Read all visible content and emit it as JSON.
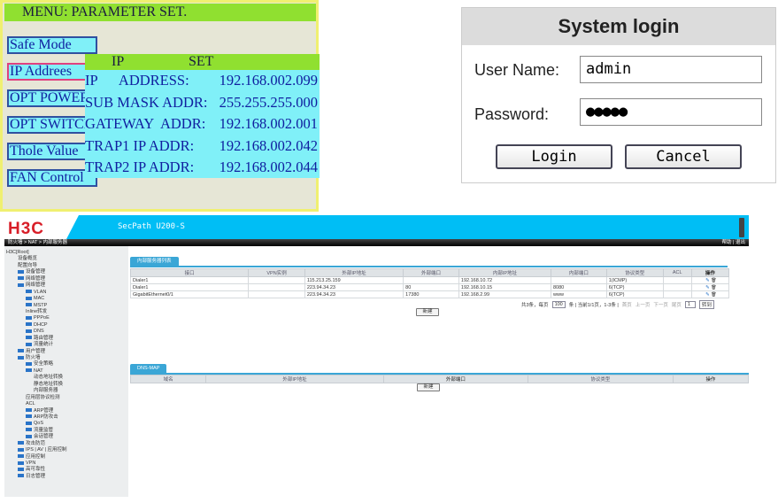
{
  "lcd": {
    "header": "MENU: PARAMETER SET.",
    "menu": [
      "Safe Mode",
      "IP Addrees",
      "OPT POWER",
      "OPT SWITCH",
      "Thole Value",
      "FAN Control"
    ],
    "popup": {
      "title_left": "IP",
      "title_right": "SET",
      "rows": [
        {
          "label": "IP      ADDRESS:",
          "value": "192.168.002.099"
        },
        {
          "label": "SUB MASK ADDR:",
          "value": "255.255.255.000"
        },
        {
          "label": "GATEWAY  ADDR:",
          "value": "192.168.002.001"
        },
        {
          "label": "TRAP1 IP ADDR:",
          "value": "192.168.002.042"
        },
        {
          "label": "TRAP2 IP ADDR:",
          "value": "192.168.002.044"
        }
      ]
    }
  },
  "login": {
    "title": "System login",
    "user_label": "User Name:",
    "user_value": "admin",
    "pass_label": "Password:",
    "pass_value": "●●●●●",
    "login_btn": "Login",
    "cancel_btn": "Cancel"
  },
  "h3c": {
    "logo": "H3C",
    "product": "SecPath U200-S",
    "breadcrumb": "防火墙 > NAT > 内部服务器",
    "top_links": "帮助 | 退出",
    "tree": [
      [
        "H3C[Root]",
        0,
        0
      ],
      [
        "设备概览",
        1,
        0
      ],
      [
        "配置向导",
        1,
        0
      ],
      [
        "设备管理",
        1,
        1
      ],
      [
        "网络管理",
        1,
        1
      ],
      [
        "网络管理",
        1,
        1
      ],
      [
        "VLAN",
        2,
        1
      ],
      [
        "MAC",
        2,
        1
      ],
      [
        "MSTP",
        2,
        1
      ],
      [
        "Inline转发",
        2,
        0
      ],
      [
        "PPPoE",
        2,
        1
      ],
      [
        "DHCP",
        2,
        1
      ],
      [
        "DNS",
        2,
        1
      ],
      [
        "路由管理",
        2,
        1
      ],
      [
        "流量统计",
        2,
        1
      ],
      [
        "用户管理",
        1,
        1
      ],
      [
        "防火墙",
        1,
        1
      ],
      [
        "安全策略",
        2,
        1
      ],
      [
        "NAT",
        2,
        1
      ],
      [
        "动态地址转换",
        3,
        0
      ],
      [
        "静态地址转换",
        3,
        0
      ],
      [
        "内部服务器",
        3,
        0
      ],
      [
        "应用层协议检测",
        2,
        0
      ],
      [
        "ACL",
        2,
        0
      ],
      [
        "ARP管理",
        2,
        1
      ],
      [
        "ARP防攻击",
        2,
        1
      ],
      [
        "QoS",
        2,
        1
      ],
      [
        "流量监管",
        2,
        1
      ],
      [
        "会话管理",
        2,
        1
      ],
      [
        "攻击防范",
        1,
        1
      ],
      [
        "IPS | AV | 应用控制",
        1,
        1
      ],
      [
        "应用控制",
        1,
        1
      ],
      [
        "VPN",
        1,
        1
      ],
      [
        "高可靠性",
        1,
        1
      ],
      [
        "日志管理",
        1,
        1
      ]
    ],
    "server_tab": "内部服务器列表",
    "columns": [
      "接口",
      "VPN实例",
      "外部IP地址",
      "外部端口",
      "内部IP地址",
      "内部端口",
      "协议类型",
      "ACL",
      "操作"
    ],
    "rows": [
      [
        "Dialer1",
        "",
        "115.213.25.159",
        "",
        "192.168.10.72",
        "",
        "1(ICMP)",
        ""
      ],
      [
        "Dialer1",
        "",
        "223.94.34.23",
        "80",
        "192.168.10.15",
        "8080",
        "6(TCP)",
        ""
      ],
      [
        "GigabitEthernet0/1",
        "",
        "223.94.34.23",
        "17380",
        "192.168.2.99",
        "www",
        "6(TCP)",
        ""
      ]
    ],
    "pagination": {
      "summary": "共3条，每页",
      "per_page": "100",
      "info": "条 | 当前1/1页，1-3条 |",
      "first": "首页",
      "prev": "上一页",
      "next": "下一页",
      "last": "尾页",
      "page": "1",
      "go": "转到"
    },
    "new_btn": "新建",
    "dns_tab": "DNS-MAP",
    "dns_columns": [
      "域名",
      "外部IP地址",
      "外部端口",
      "协议类型",
      "操作"
    ],
    "dns_new_btn": "新建"
  }
}
